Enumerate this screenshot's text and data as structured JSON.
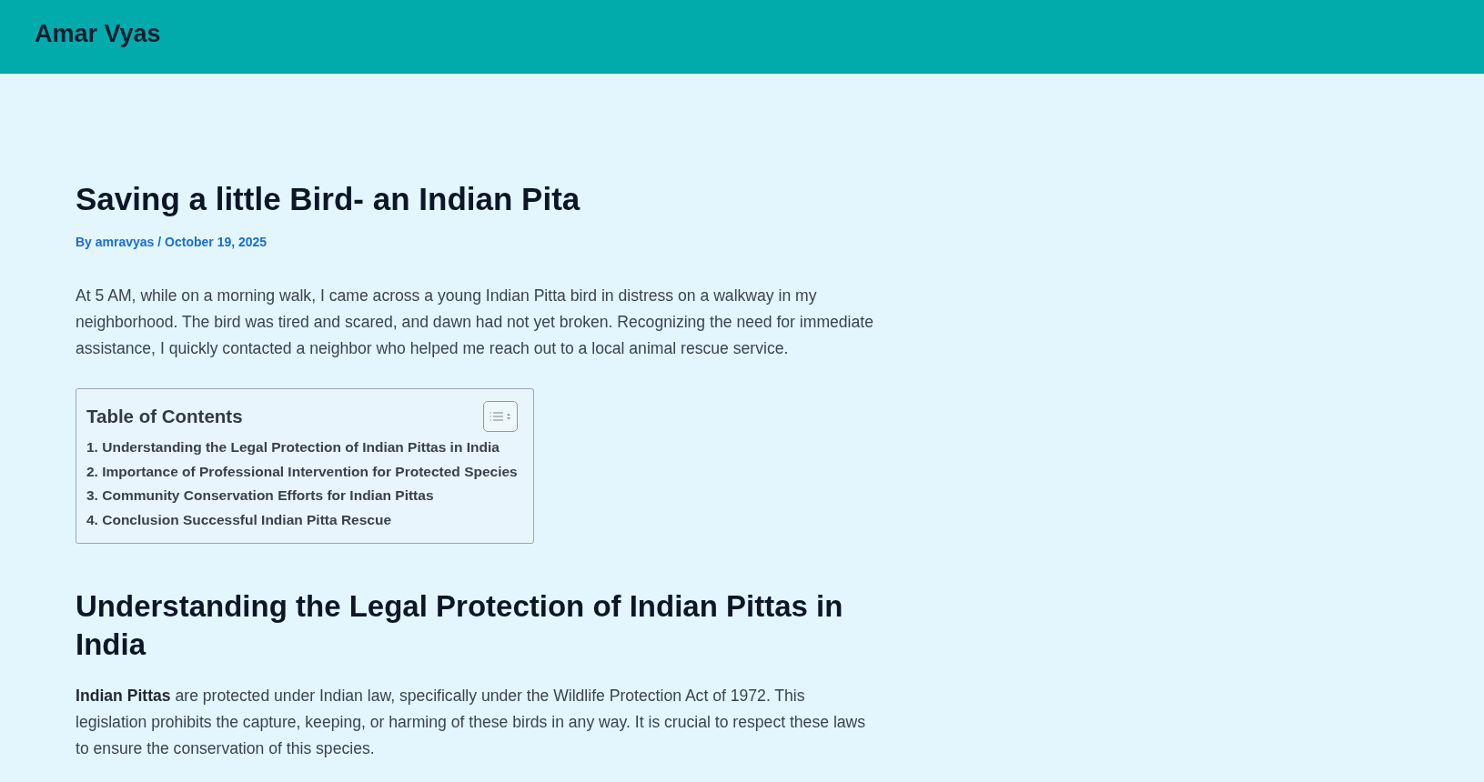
{
  "header": {
    "site_title": "Amar Vyas"
  },
  "article": {
    "title": "Saving a little Bird- an Indian Pita",
    "meta": "By amravyas / October 19, 2025",
    "intro": "At 5 AM, while on a morning walk, I came across a young Indian Pitta bird in distress on a walkway in my neighborhood. The bird was tired and scared, and dawn had not yet broken. Recognizing the need for immediate assistance, I quickly contacted a neighbor who helped me reach out to a local animal rescue service.",
    "toc": {
      "title": "Table of Contents",
      "items": [
        "1. Understanding the Legal Protection of Indian Pittas in India",
        "2. Importance of Professional Intervention for Protected Species",
        "3. Community Conservation Efforts for Indian Pittas",
        "4. Conclusion Successful Indian Pitta Rescue"
      ]
    },
    "sections": [
      {
        "heading": "Understanding the Legal Protection of Indian Pittas in India",
        "paragraphs": [
          "**Indian Pittas** are protected under Indian law, specifically under the Wildlife Protection Act of 1972. This legislation prohibits the capture, keeping, or harming of these birds in any way. It is crucial to respect these laws to ensure the conservation of this species."
        ]
      }
    ]
  }
}
